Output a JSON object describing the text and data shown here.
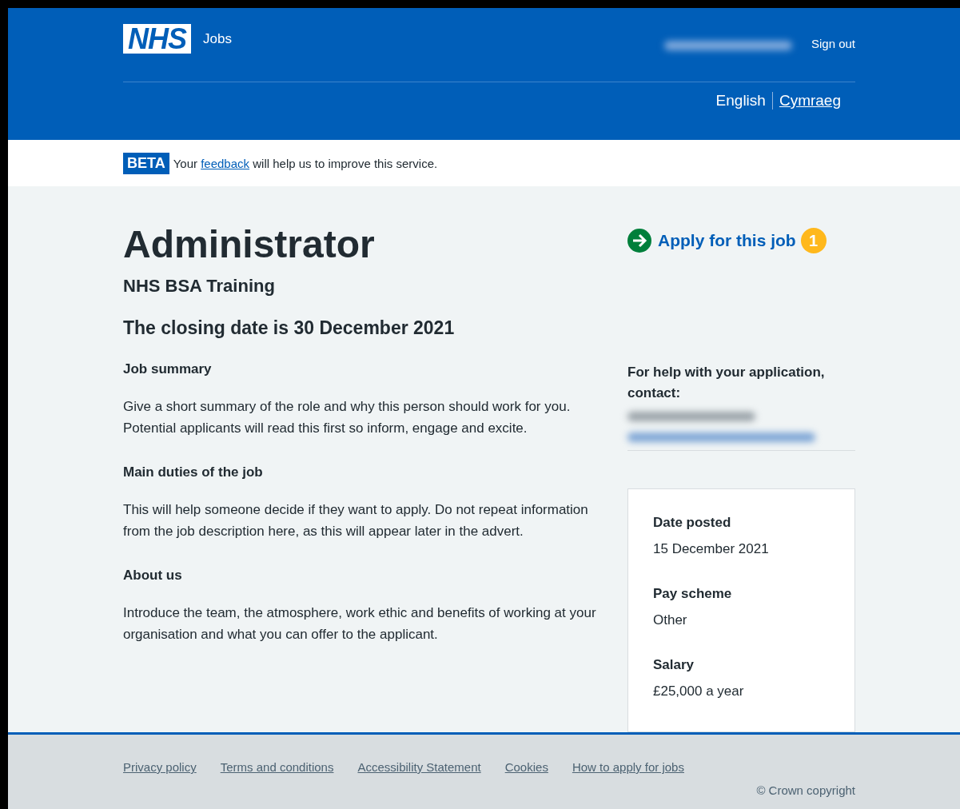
{
  "header": {
    "logo": "NHS",
    "service": "Jobs",
    "sign_out": "Sign out",
    "languages": [
      {
        "label": "English",
        "selected": true
      },
      {
        "label": "Cymraeg",
        "selected": false
      }
    ]
  },
  "banner": {
    "tag": "BETA",
    "before": "Your",
    "link": "feedback",
    "after": "will help us to improve this service."
  },
  "job": {
    "title": "Administrator",
    "employer": "NHS BSA Training",
    "closing": "The closing date is 30 December 2021",
    "sections": [
      {
        "heading": "Job summary",
        "text": "Give a short summary of the role and why this person should work for you. Potential applicants will read this first so inform, engage and excite."
      },
      {
        "heading": "Main duties of the job",
        "text": "This will help someone decide if they want to apply. Do not repeat information from the job description here, as this will appear later in the advert."
      },
      {
        "heading": "About us",
        "text": "Introduce the team, the atmosphere, work ethic and benefits of working at your organisation and what you can offer to the applicant."
      }
    ]
  },
  "apply": {
    "label": "Apply for this job",
    "badge": "1"
  },
  "contact": {
    "heading": "For help with your application, contact:"
  },
  "details": [
    {
      "label": "Date posted",
      "value": "15 December 2021"
    },
    {
      "label": "Pay scheme",
      "value": "Other"
    },
    {
      "label": "Salary",
      "value": "£25,000 a year"
    }
  ],
  "footer": {
    "links": [
      "Privacy policy",
      "Terms and conditions",
      "Accessibility Statement",
      "Cookies",
      "How to apply for jobs"
    ],
    "copyright": "© Crown copyright"
  }
}
